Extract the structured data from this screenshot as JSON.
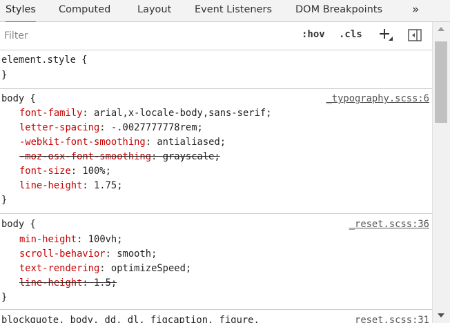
{
  "tabs": [
    "Styles",
    "Computed",
    "Layout",
    "Event Listeners",
    "DOM Breakpoints",
    "»"
  ],
  "filter": {
    "placeholder": "Filter"
  },
  "toolbar": {
    "hov": ":hov",
    "cls": ".cls",
    "plus": "+"
  },
  "rules": [
    {
      "selector": "element.style {",
      "source": "",
      "props": [],
      "close": "}"
    },
    {
      "selector": "body {",
      "source": "_typography.scss:6",
      "props": [
        {
          "name": "font-family",
          "value": "arial,x-locale-body,sans-serif;",
          "struck": false
        },
        {
          "name": "letter-spacing",
          "value": "-.0027777778rem;",
          "struck": false
        },
        {
          "name": "-webkit-font-smoothing",
          "value": "antialiased;",
          "struck": false
        },
        {
          "name": "-moz-osx-font-smoothing",
          "value": "grayscale;",
          "struck": true
        },
        {
          "name": "font-size",
          "value": "100%;",
          "struck": false
        },
        {
          "name": "line-height",
          "value": "1.75;",
          "struck": false
        }
      ],
      "close": "}"
    },
    {
      "selector": "body {",
      "source": "_reset.scss:36",
      "props": [
        {
          "name": "min-height",
          "value": "100vh;",
          "struck": false
        },
        {
          "name": "scroll-behavior",
          "value": "smooth;",
          "struck": false
        },
        {
          "name": "text-rendering",
          "value": "optimizeSpeed;",
          "struck": false
        },
        {
          "name": "line-height",
          "value": "1.5;",
          "struck": true
        }
      ],
      "close": "}"
    },
    {
      "selector": "blockquote, body, dd, dl, figcaption, figure,",
      "source": "_reset.scss:31",
      "props": [],
      "close": ""
    }
  ],
  "colors": {
    "property": "#c80000",
    "tab_active": "#1a73e8",
    "separator": "#cbcbcb"
  }
}
